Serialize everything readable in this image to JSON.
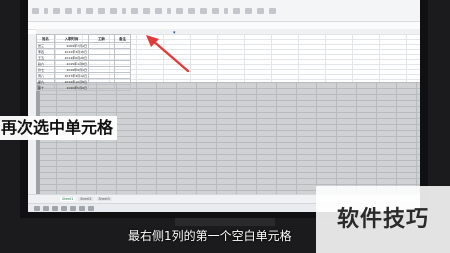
{
  "spreadsheet": {
    "headers": [
      "姓名",
      "入职时间",
      "工龄",
      "备注"
    ],
    "rows": [
      [
        "张三",
        "2009年7月1日",
        "",
        ""
      ],
      [
        "李四",
        "2012年3月15日",
        "",
        ""
      ],
      [
        "王五",
        "2014年6月20日",
        "",
        ""
      ],
      [
        "赵六",
        "2015年1月8日",
        "",
        ""
      ],
      [
        "孙七",
        "2016年9月1日",
        "",
        ""
      ],
      [
        "周八",
        "2017年4月12日",
        "",
        ""
      ],
      [
        "吴九",
        "2019年10月8日",
        "",
        ""
      ],
      [
        "郑十",
        "2020年5月6日",
        "",
        ""
      ]
    ],
    "sheet_tabs": [
      "Sheet1",
      "Sheet2",
      "Sheet3"
    ],
    "active_sheet_index": 0
  },
  "overlays": {
    "caption_big": "再次选中单元格",
    "subtitle": "最右侧1列的第一个空白单元格",
    "watermark": "软件技巧"
  },
  "colors": {
    "selection_gray": "#cfd1d3",
    "arrow_red": "#e03b3b",
    "accent_blue": "#3a86d4"
  },
  "icons": {
    "pointer": "arrow-pointer-icon",
    "badge": "assistant-badge-icon"
  }
}
